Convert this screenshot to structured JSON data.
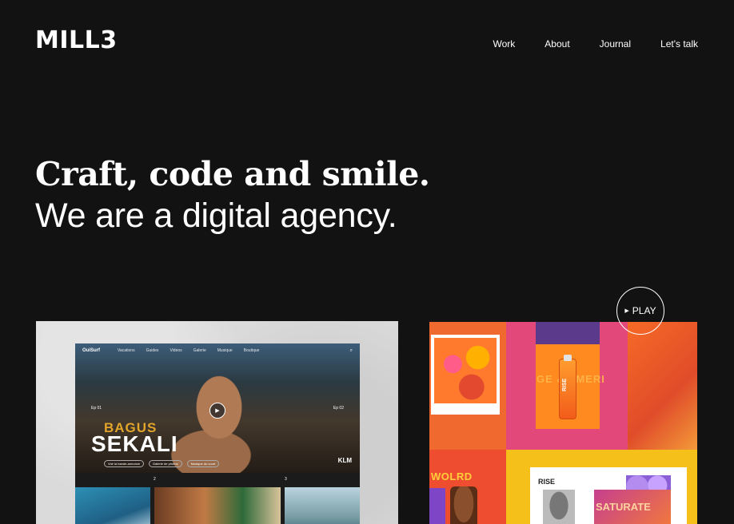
{
  "brand": {
    "logo": "MILL3"
  },
  "nav": {
    "items": [
      "Work",
      "About",
      "Journal",
      "Let's talk"
    ]
  },
  "hero": {
    "headline": "Craft, code and smile.",
    "subheadline": "We are a digital agency."
  },
  "project_ouisurf": {
    "site_brand": "OuiSurf",
    "nav_items": [
      "Vacations",
      "Guides",
      "Videos",
      "Galerie",
      "Musique",
      "Boutique"
    ],
    "title_top": "BAGUS",
    "title_bottom": "SEKALI",
    "ep_left": "Ep 01",
    "ep_right": "Ep 02",
    "chips": [
      "Voir la bande-annonce",
      "Galerie de photos",
      "Musique du court"
    ],
    "partner": "KLM",
    "nums": [
      "2",
      "3"
    ]
  },
  "project_rise": {
    "can_words": "GE & TMERI",
    "bottle_label": "RISE",
    "wolrd": "WOLRD",
    "rise_header": "RISE",
    "saturate": "SATURATE"
  },
  "play_button": {
    "label": "PLAY",
    "icon": "play-triangle-icon"
  }
}
